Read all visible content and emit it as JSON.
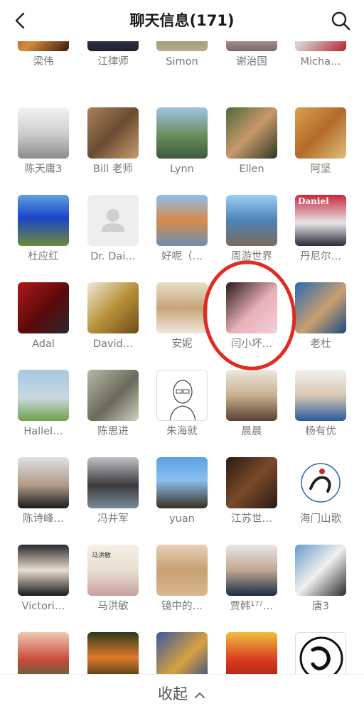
{
  "header": {
    "title": "聊天信息(171)"
  },
  "rows": [
    [
      {
        "name": "梁伟",
        "bg": "linear-gradient(135deg,#7a3d1a,#d48a3a 55%,#3a1a0a)"
      },
      {
        "name": "江律师",
        "bg": "linear-gradient(180deg,#d9d9d9,#3b3f4a 60%,#1d2230)"
      },
      {
        "name": "Simon",
        "bg": "linear-gradient(180deg,#c9c3ad,#8d8a75 60%,#b7ad88)"
      },
      {
        "name": "谢治国",
        "bg": "linear-gradient(180deg,#efe7e0,#c9b8b0 55%,#7d6a66)"
      },
      {
        "name": "Micha…",
        "bg": "linear-gradient(135deg,#1f3c8a,#d8d8d8 45%,#b7222a)"
      }
    ],
    [
      {
        "name": "陈天庸3",
        "bg": "linear-gradient(180deg,#f3f3f3,#cfcfcf 50%,#8c8c8c)"
      },
      {
        "name": "Bill 老师",
        "bg": "linear-gradient(135deg,#a8805a,#6b4d33 50%,#c89b6a)"
      },
      {
        "name": "Lynn",
        "bg": "linear-gradient(180deg,#9fc3e6,#6a8e5a 55%,#3a5a3a)"
      },
      {
        "name": "Ellen",
        "bg": "linear-gradient(135deg,#4c6b3a,#c9986b 50%,#2a3a20)"
      },
      {
        "name": "阿坚",
        "bg": "linear-gradient(135deg,#d8a24a,#b36a2a 50%,#e0c07a)"
      }
    ],
    [
      {
        "name": "杜应红",
        "bg": "linear-gradient(180deg,#5fa0e0,#1a44c8 45%,#6f8a3a)"
      },
      {
        "name": "Dr. Dai…",
        "bg": "#eeeeee",
        "placeholder": true
      },
      {
        "name": "好呢（…",
        "bg": "linear-gradient(180deg,#8bc0ee,#d98a4a 50%,#6a8fb0)"
      },
      {
        "name": "周游世界",
        "bg": "linear-gradient(180deg,#9ad0f5,#4c83b8 50%,#7b6a5a)"
      },
      {
        "name": "丹尼尔…",
        "bg": "linear-gradient(180deg,#c8283a,#e6e6e6 55%,#2a2a3a)",
        "badge": "Daniel"
      }
    ],
    [
      {
        "name": "Adal",
        "bg": "linear-gradient(135deg,#b01818,#5a0a0a 55%,#2a2a2a)"
      },
      {
        "name": "David…",
        "bg": "linear-gradient(135deg,#f0ead8,#b8923a 50%,#6a4c1a)"
      },
      {
        "name": "安妮",
        "bg": "linear-gradient(180deg,#e6e0c8,#c9a47a 50%,#f0e8e0)"
      },
      {
        "name": "闫小坏…",
        "bg": "linear-gradient(135deg,#2a1a1a,#e8b0b8 55%,#f4d0d8)"
      },
      {
        "name": "老杜",
        "bg": "linear-gradient(135deg,#2a6ab0,#c9a070 55%,#1a4a80)"
      }
    ],
    [
      {
        "name": "Hallel…",
        "bg": "linear-gradient(180deg,#a8c8e0,#c8d8e0 55%,#6fa04a)"
      },
      {
        "name": "陈思进",
        "bg": "linear-gradient(135deg,#b8b8a8,#6a6a5a 55%,#d0d0c0)"
      },
      {
        "name": "朱海就",
        "bg": "#ffffff",
        "sketch": true
      },
      {
        "name": "晨晨",
        "bg": "linear-gradient(180deg,#ede8e0,#c8b090 50%,#5a4030)"
      },
      {
        "name": "杨有优",
        "bg": "linear-gradient(180deg,#f0f0f0,#d8c8b0 50%,#2a5aa0)"
      }
    ],
    [
      {
        "name": "陈诗峰…",
        "bg": "linear-gradient(180deg,#e0e0e0,#b09a88 55%,#1a1a1a)"
      },
      {
        "name": "冯井军",
        "bg": "linear-gradient(180deg,#c0c0c8,#3a3a3a 55%,#7a8a9a)"
      },
      {
        "name": "yuan",
        "bg": "linear-gradient(180deg,#5aa0e0,#8ac0f0 45%,#3a3020)"
      },
      {
        "name": "江苏世…",
        "bg": "linear-gradient(135deg,#2a1a10,#7a4a2a 50%,#2a1a10)"
      },
      {
        "name": "海门山歌",
        "bg": "#ffffff",
        "logo": true
      }
    ],
    [
      {
        "name": "Victori…",
        "bg": "linear-gradient(180deg,#2a2a2a,#e8ddd0 50%,#1a1a1a)"
      },
      {
        "name": "马洪敏",
        "bg": "linear-gradient(180deg,#f4f0e8,#e8e0d0 50%,#c8a0a0)",
        "badge2": "马洪敏"
      },
      {
        "name": "镜中的…",
        "bg": "linear-gradient(180deg,#e8d0b8,#c8a070 50%,#d8b890)"
      },
      {
        "name": "贾韩¹⁷⁷…",
        "bg": "linear-gradient(180deg,#e8e8e8,#c0a890 50%,#1a2a4a)"
      },
      {
        "name": "唐3",
        "bg": "linear-gradient(135deg,#6a9ac8,#f0f0f0 50%,#2a2a2a)"
      }
    ],
    [
      {
        "name": "",
        "bg": "linear-gradient(180deg,#f0c8b0,#c84a3a 55%,#3a6a3a)"
      },
      {
        "name": "",
        "bg": "linear-gradient(180deg,#2a3a1a,#e07a2a 50%,#1a2a10)"
      },
      {
        "name": "",
        "bg": "linear-gradient(135deg,#3a5aa0,#d8a040 55%,#2a4a8a)"
      },
      {
        "name": "",
        "bg": "linear-gradient(180deg,#f0c040,#d83a20 55%,#a02010)"
      },
      {
        "name": "",
        "bg": "#ffffff",
        "seal": "猴"
      }
    ]
  ],
  "footer": {
    "collapse_label": "收起"
  },
  "colors": {
    "highlight": "#e02b20",
    "label": "#777777"
  }
}
